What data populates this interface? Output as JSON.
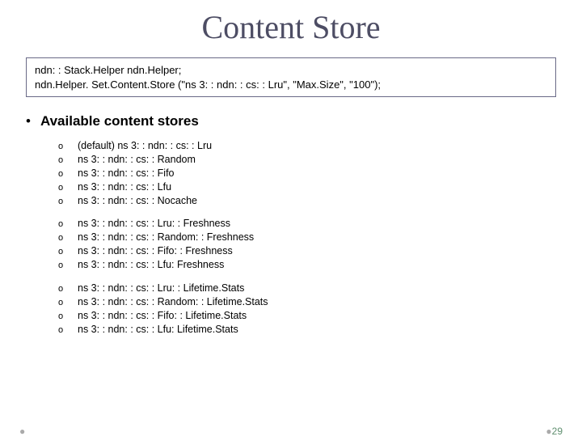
{
  "title": "Content Store",
  "code": {
    "line1": "ndn: : Stack.Helper ndn.Helper;",
    "line2": "ndn.Helper. Set.Content.Store (\"ns 3: : ndn: : cs: : Lru\", \"Max.Size\", \"100\");"
  },
  "section_heading": "Available content stores",
  "groups": [
    {
      "items": [
        "(default) ns 3: : ndn: : cs: : Lru",
        "ns 3: : ndn: : cs: : Random",
        "ns 3: : ndn: : cs: : Fifo",
        "ns 3: : ndn: : cs: : Lfu",
        "ns 3: : ndn: : cs: : Nocache"
      ]
    },
    {
      "items": [
        "ns 3: : ndn: : cs: : Lru: : Freshness",
        "ns 3: : ndn: : cs: : Random: : Freshness",
        "ns 3: : ndn: : cs: : Fifo: : Freshness",
        "ns 3: : ndn: : cs: : Lfu: Freshness"
      ]
    },
    {
      "items": [
        "ns 3: : ndn: : cs: : Lru: : Lifetime.Stats",
        "ns 3: : ndn: : cs: : Random: : Lifetime.Stats",
        "ns 3: : ndn: : cs: : Fifo: : Lifetime.Stats",
        "ns 3: : ndn: : cs: : Lfu: Lifetime.Stats"
      ]
    }
  ],
  "page_number": "29"
}
